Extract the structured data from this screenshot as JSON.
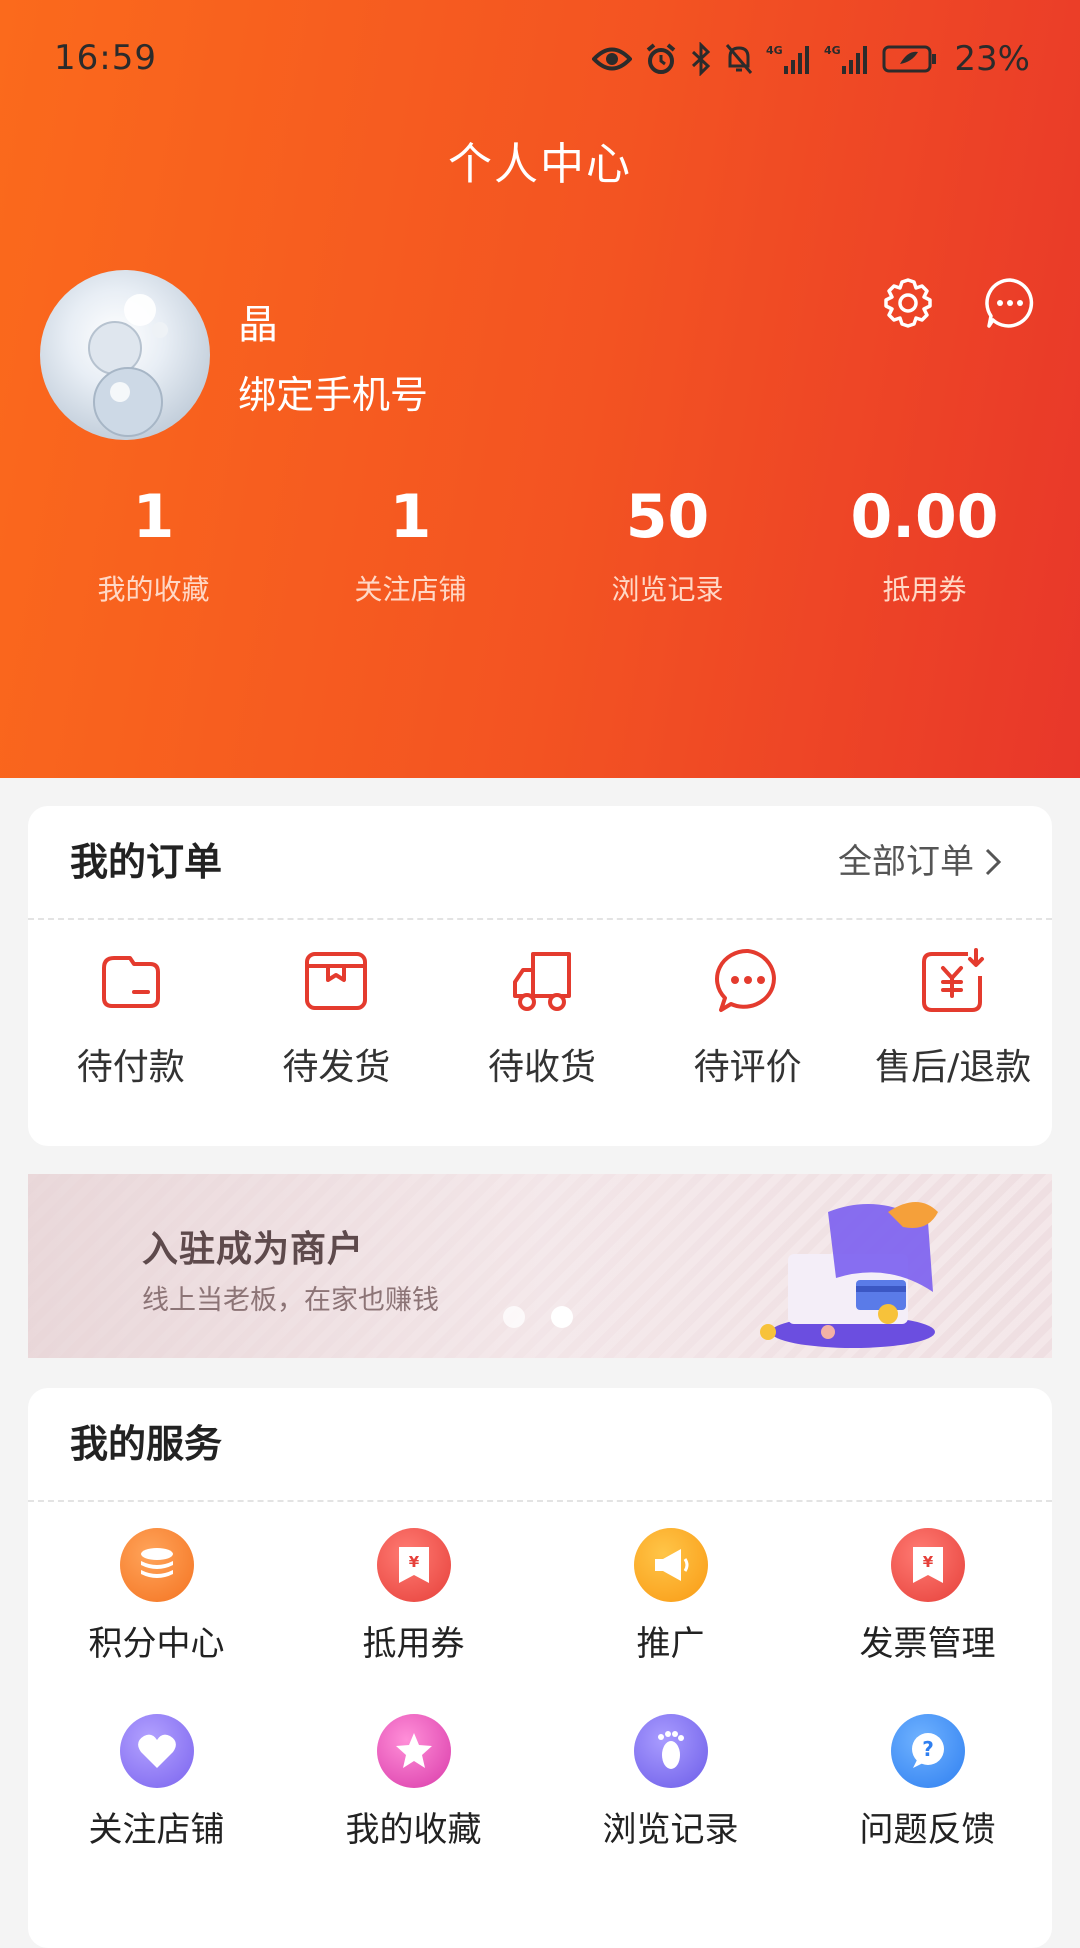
{
  "status_bar": {
    "time": "16:59",
    "battery": "23%"
  },
  "header": {
    "title": "个人中心"
  },
  "profile": {
    "username": "晶",
    "bind_phone": "绑定手机号"
  },
  "stats": [
    {
      "value": "1",
      "label": "我的收藏"
    },
    {
      "value": "1",
      "label": "关注店铺"
    },
    {
      "value": "50",
      "label": "浏览记录"
    },
    {
      "value": "0.00",
      "label": "抵用券"
    }
  ],
  "orders": {
    "title": "我的订单",
    "all_link": "全部订单",
    "items": [
      {
        "label": "待付款",
        "icon": "wallet-icon"
      },
      {
        "label": "待发货",
        "icon": "box-icon"
      },
      {
        "label": "待收货",
        "icon": "truck-icon"
      },
      {
        "label": "待评价",
        "icon": "comment-icon"
      },
      {
        "label": "售后/退款",
        "icon": "refund-icon"
      }
    ]
  },
  "banner": {
    "title": "入驻成为商户",
    "subtitle": "线上当老板，在家也赚钱",
    "slides": 2,
    "active_slide": 2
  },
  "services": {
    "title": "我的服务",
    "items": [
      {
        "label": "积分中心",
        "icon": "coins-icon",
        "color": "#f97b2a"
      },
      {
        "label": "抵用券",
        "icon": "coupon-icon",
        "color": "#ef4b43"
      },
      {
        "label": "推广",
        "icon": "megaphone-icon",
        "color": "#f9a21c"
      },
      {
        "label": "发票管理",
        "icon": "invoice-icon",
        "color": "#ef4b43"
      },
      {
        "label": "关注店铺",
        "icon": "heart-icon",
        "color": "#8a74f0"
      },
      {
        "label": "我的收藏",
        "icon": "star-icon",
        "color": "#e44fb7"
      },
      {
        "label": "浏览记录",
        "icon": "footprint-icon",
        "color": "#7a6ff0"
      },
      {
        "label": "问题反馈",
        "icon": "question-icon",
        "color": "#3d8df5"
      }
    ]
  },
  "colors": {
    "header_start": "#fb6a1c",
    "header_end": "#e8372a",
    "accent_red": "#e43b2e"
  }
}
